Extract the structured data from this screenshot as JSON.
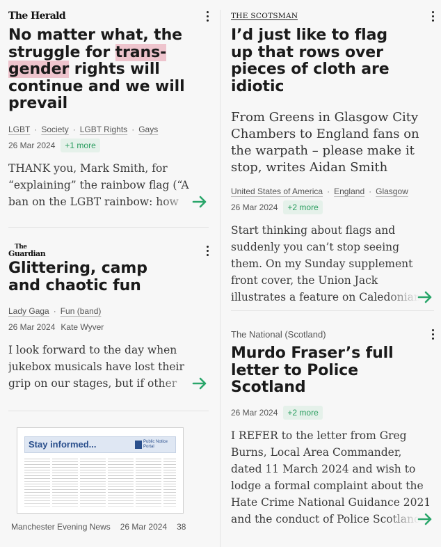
{
  "left": {
    "card1": {
      "source": "The Herald",
      "headline_parts": [
        "No matter what, the struggle for ",
        "trans-gender",
        " rights will continue and we will prevail"
      ],
      "tags": [
        "LGBT",
        "Society",
        "LGBT Rights",
        "Gays"
      ],
      "date": "26 Mar 2024",
      "more": "+1 more",
      "excerpt": "THANK you, Mark Smith, for “explaining” the rainbow flag (“A ban on the LGBT rainbow: how"
    },
    "card2": {
      "source": "The Guardian",
      "headline": "Glittering, camp and chaotic fun",
      "tags": [
        "Lady Gaga",
        "Fun (band)"
      ],
      "date": "26 Mar 2024",
      "author": "Kate Wyver",
      "excerpt": "I look forward to the day when jukebox musicals have lost their grip on our stages, but if other people"
    },
    "card3": {
      "thumb_title": "Stay informed...",
      "thumb_badge": "Public Notice Portal",
      "source": "Manchester Evening News",
      "date": "26 Mar 2024",
      "page": "38"
    }
  },
  "right": {
    "card1": {
      "source": "The Scotsman",
      "headline": "I’d just like to flag up that rows over pieces of cloth are idiotic",
      "subhead": "From Greens in Glasgow City Chambers to England fans on the warpath – please make it stop, writes Aidan Smith",
      "tags": [
        "United States of America",
        "England",
        "Glasgow"
      ],
      "date": "26 Mar 2024",
      "more": "+2 more",
      "excerpt": "Start thinking about flags and suddenly you can’t stop seeing them. On my Sunday supplement front cover, the Union Jack illustrates a feature on Caledonian Road, the"
    },
    "card2": {
      "source": "The National (Scotland)",
      "headline": "Murdo Fraser’s full letter to Police Scotland",
      "date": "26 Mar 2024",
      "more": "+2 more",
      "excerpt": "I REFER to the letter from Greg Burns, Local Area Commander, dated 11 March 2024 and wish to lodge a formal complaint about the Hate Crime National Guidance 2021 and the conduct of Police Scotland"
    }
  },
  "icons": [
    "more-vert-icon",
    "arrow-right-icon"
  ],
  "colors": {
    "accent": "#2aa66a",
    "highlight": "#eec4cd",
    "pill_bg": "#e5f1ea",
    "divider": "#e2e2e2"
  }
}
